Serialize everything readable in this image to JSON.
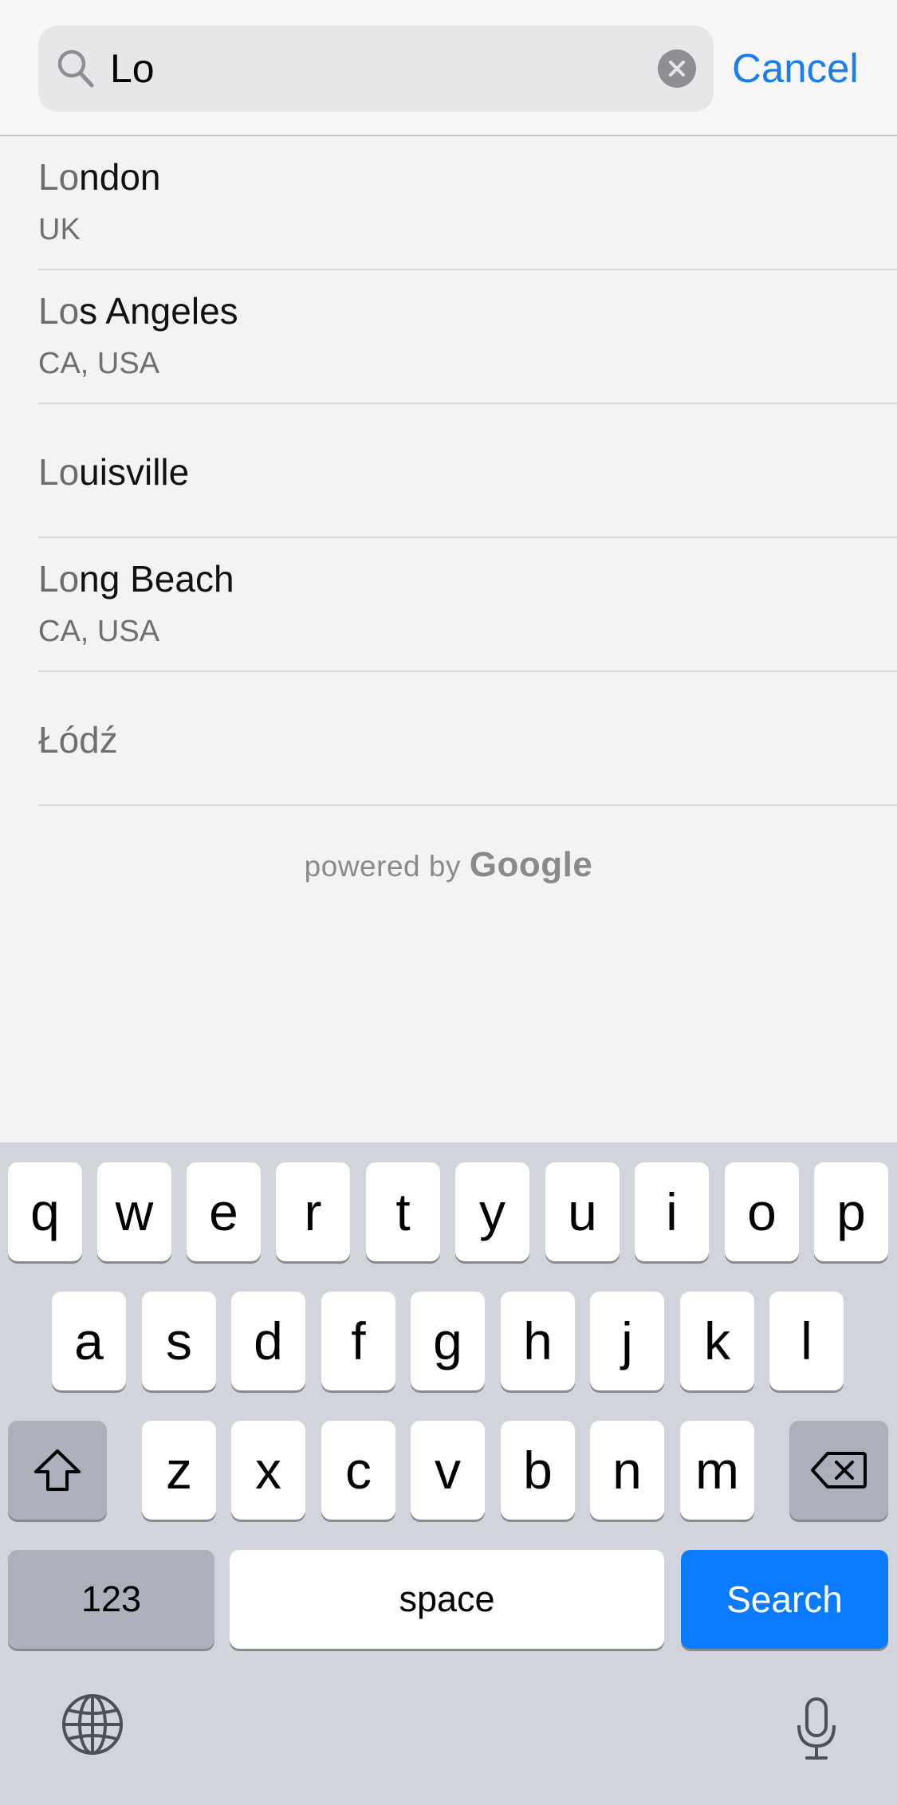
{
  "search": {
    "value": "Lo",
    "cancel_label": "Cancel"
  },
  "results": [
    {
      "match": "Lo",
      "rest": "ndon",
      "subtitle": "UK"
    },
    {
      "match": "Lo",
      "rest": "s Angeles",
      "subtitle": "CA, USA"
    },
    {
      "match": "Lo",
      "rest": "uisville",
      "subtitle": ""
    },
    {
      "match": "Lo",
      "rest": "ng Beach",
      "subtitle": "CA, USA"
    },
    {
      "title": "Łódź"
    }
  ],
  "attribution": {
    "prefix": "powered by",
    "brand": "Google"
  },
  "keyboard": {
    "row1": [
      "q",
      "w",
      "e",
      "r",
      "t",
      "y",
      "u",
      "i",
      "o",
      "p"
    ],
    "row2": [
      "a",
      "s",
      "d",
      "f",
      "g",
      "h",
      "j",
      "k",
      "l"
    ],
    "row3": [
      "z",
      "x",
      "c",
      "v",
      "b",
      "n",
      "m"
    ],
    "numbers_label": "123",
    "space_label": "space",
    "search_label": "Search",
    "icons": {
      "shift": "shift-icon",
      "delete": "backspace-icon",
      "globe": "globe-icon",
      "mic": "microphone-icon"
    }
  },
  "colors": {
    "accent": "#1b7cf2",
    "search_key": "#0a7aff",
    "keyboard_bg": "#d1d5db"
  }
}
